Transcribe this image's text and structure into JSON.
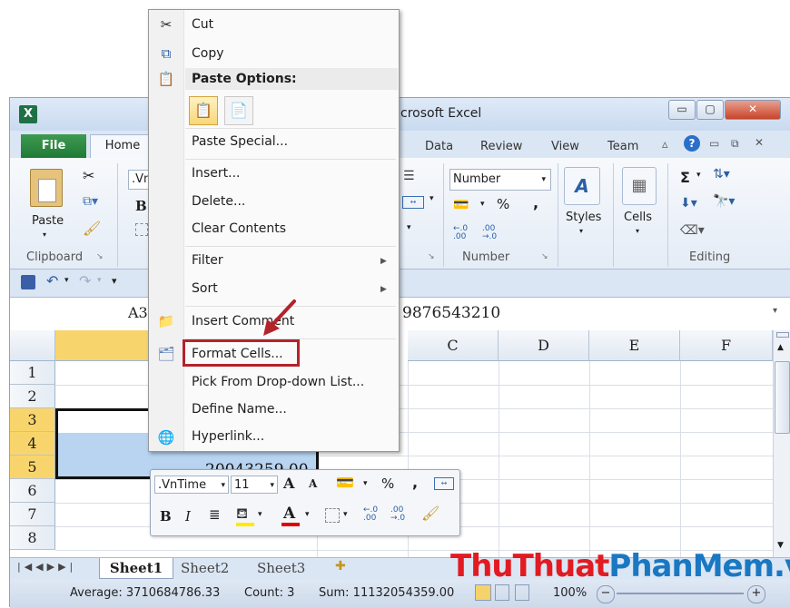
{
  "window": {
    "title": "Microsoft Excel",
    "title_visible": "crosoft Excel",
    "app_icon": "X",
    "controls": {
      "minimize": "▭",
      "maximize": "▢",
      "close": "✕"
    }
  },
  "ribbon": {
    "tabs": [
      {
        "label": "File",
        "active": false
      },
      {
        "label": "Home",
        "active": true
      },
      {
        "label": "Data"
      },
      {
        "label": "Review"
      },
      {
        "label": "View"
      },
      {
        "label": "Team"
      }
    ],
    "clipboard": {
      "paste_label": "Paste",
      "group_label": "Clipboard"
    },
    "font": {
      "font_name": ".Vn",
      "bold": "B"
    },
    "number": {
      "format": "Number",
      "percent": "%",
      "comma": ",",
      "inc_decimal": "←.0 .00",
      "dec_decimal": ".00 →.0",
      "group_label": "Number"
    },
    "styles": {
      "label": "Styles"
    },
    "cells": {
      "label": "Cells"
    },
    "editing": {
      "sigma": "Σ",
      "group_label": "Editing"
    }
  },
  "formula_bar": {
    "name_box": "A3",
    "value": "9876543210"
  },
  "grid": {
    "columns": [
      "C",
      "D",
      "E",
      "F"
    ],
    "rows": [
      "1",
      "2",
      "3",
      "4",
      "5",
      "6",
      "7",
      "8"
    ],
    "selected_rows": [
      "3",
      "4",
      "5"
    ],
    "partial_cell_value": "20043259.00"
  },
  "sheet_tabs": [
    "Sheet1",
    "Sheet2",
    "Sheet3"
  ],
  "status_bar": {
    "average": "Average: 3710684786.33",
    "count": "Count: 3",
    "sum": "Sum: 11132054359.00",
    "zoom": "100%"
  },
  "context_menu": {
    "items": [
      {
        "label": "Cut",
        "icon": "scissors-icon"
      },
      {
        "label": "Copy",
        "icon": "copy-icon"
      },
      {
        "label": "Paste Options:",
        "icon": "paste-icon",
        "header": true
      },
      {
        "label": "Paste Special..."
      },
      {
        "label": "Insert..."
      },
      {
        "label": "Delete..."
      },
      {
        "label": "Clear Contents"
      },
      {
        "label": "Filter",
        "submenu": true
      },
      {
        "label": "Sort",
        "submenu": true
      },
      {
        "label": "Insert Comment",
        "icon": "comment-icon"
      },
      {
        "label": "Format Cells...",
        "icon": "format-cells-icon",
        "highlighted": true
      },
      {
        "label": "Pick From Drop-down List..."
      },
      {
        "label": "Define Name..."
      },
      {
        "label": "Hyperlink...",
        "icon": "hyperlink-icon"
      }
    ]
  },
  "mini_toolbar": {
    "font": ".VnTime",
    "size": "11",
    "grow": "A",
    "shrink": "A",
    "percent": "%",
    "comma": ",",
    "bold": "B",
    "italic": "I",
    "font_color": "A",
    "inc_decimal": "←.0 .00",
    "dec_decimal": ".00 →.0"
  },
  "watermark": {
    "part1": "Thu",
    "part2": "Thuat",
    "part3": "PhanMem",
    "part4": ".vn"
  },
  "colors": {
    "accent_red": "#b3232b",
    "file_tab": "#2b8a41",
    "selection": "#b8d4f0"
  }
}
